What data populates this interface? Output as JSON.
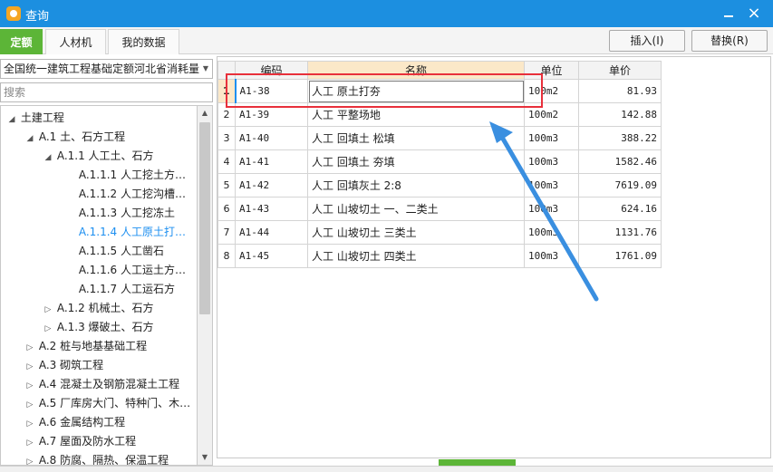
{
  "window": {
    "title": "查询",
    "close_glyph": "×",
    "accent_color": "#1c8fe0"
  },
  "tabs": [
    {
      "label": "定额"
    },
    {
      "label": "人材机"
    },
    {
      "label": "我的数据"
    }
  ],
  "toolbar": {
    "insert_label": "插入(I)",
    "replace_label": "替换(R)"
  },
  "left": {
    "quota_library": "全国统一建筑工程基础定额河北省消耗量",
    "search_placeholder": "搜索",
    "tree": [
      {
        "label": "土建工程",
        "toggle": "◢"
      },
      {
        "label": "A.1 土、石方工程",
        "toggle": "◢"
      },
      {
        "label": "A.1.1 人工土、石方",
        "toggle": "◢"
      },
      {
        "label": "A.1.1.1 人工挖土方…",
        "toggle": ""
      },
      {
        "label": "A.1.1.2 人工挖沟槽…",
        "toggle": ""
      },
      {
        "label": "A.1.1.3 人工挖冻土",
        "toggle": ""
      },
      {
        "label": "A.1.1.4 人工原土打…",
        "toggle": ""
      },
      {
        "label": "A.1.1.5 人工凿石",
        "toggle": ""
      },
      {
        "label": "A.1.1.6 人工运土方…",
        "toggle": ""
      },
      {
        "label": "A.1.1.7 人工运石方",
        "toggle": ""
      },
      {
        "label": "A.1.2 机械土、石方",
        "toggle": "▷"
      },
      {
        "label": "A.1.3 爆破土、石方",
        "toggle": "▷"
      },
      {
        "label": "A.2 桩与地基基础工程",
        "toggle": "▷"
      },
      {
        "label": "A.3 砌筑工程",
        "toggle": "▷"
      },
      {
        "label": "A.4 混凝土及钢筋混凝土工程",
        "toggle": "▷"
      },
      {
        "label": "A.5 厂库房大门、特种门、木…",
        "toggle": "▷"
      },
      {
        "label": "A.6 金属结构工程",
        "toggle": "▷"
      },
      {
        "label": "A.7 屋面及防水工程",
        "toggle": "▷"
      },
      {
        "label": "A.8 防腐、隔热、保温工程",
        "toggle": "▷"
      }
    ]
  },
  "grid": {
    "headers": {
      "code": "编码",
      "name": "名称",
      "unit": "单位",
      "price": "单价"
    },
    "rows": [
      {
        "idx": "1",
        "code": "A1-38",
        "name": "人工 原土打夯",
        "unit": "100m2",
        "price": "81.93"
      },
      {
        "idx": "2",
        "code": "A1-39",
        "name": "人工 平整场地",
        "unit": "100m2",
        "price": "142.88"
      },
      {
        "idx": "3",
        "code": "A1-40",
        "name": "人工 回填土 松填",
        "unit": "100m3",
        "price": "388.22"
      },
      {
        "idx": "4",
        "code": "A1-41",
        "name": "人工 回填土 夯填",
        "unit": "100m3",
        "price": "1582.46"
      },
      {
        "idx": "5",
        "code": "A1-42",
        "name": "人工 回填灰土 2:8",
        "unit": "100m3",
        "price": "7619.09"
      },
      {
        "idx": "6",
        "code": "A1-43",
        "name": "人工 山坡切土 一、二类土",
        "unit": "100m3",
        "price": "624.16"
      },
      {
        "idx": "7",
        "code": "A1-44",
        "name": "人工 山坡切土 三类土",
        "unit": "100m3",
        "price": "1131.76"
      },
      {
        "idx": "8",
        "code": "A1-45",
        "name": "人工 山坡切土 四类土",
        "unit": "100m3",
        "price": "1761.09"
      }
    ]
  },
  "colors": {
    "active_tab": "#5cb537",
    "selected_tree": "#1d8ff0",
    "highlight_box": "#e8303b",
    "arrow": "#3a8fe0"
  }
}
